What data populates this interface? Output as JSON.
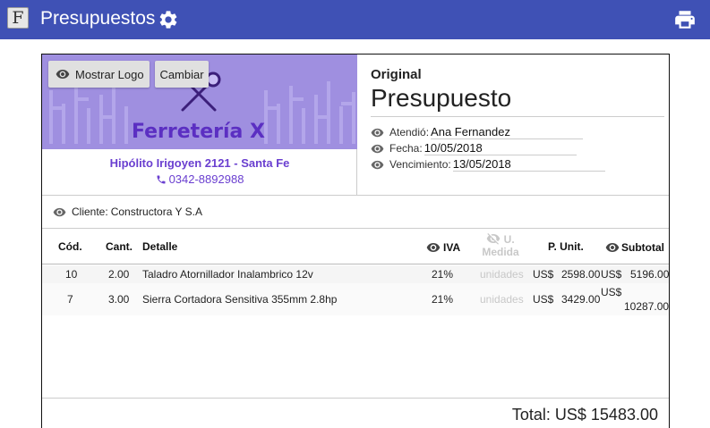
{
  "appbar": {
    "logo_glyph": "F",
    "title": "Presupuestos",
    "settings_icon": "gear-icon",
    "print_icon": "printer-icon",
    "color": "#3f51b5"
  },
  "logo_area": {
    "show_logo_label": "Mostrar Logo",
    "change_label": "Cambiar",
    "brand_name": "Ferretería X",
    "address": "Hipólito Irigoyen 2121 - Santa Fe",
    "phone": "0342-8892988",
    "banner_color": "#9f8fe0",
    "brand_color": "#5b2fc2"
  },
  "header": {
    "copy_type": "Original",
    "title": "Presupuesto",
    "attended_label": "Atendió:",
    "attended_value": "Ana Fernandez",
    "date_label": "Fecha:",
    "date_value": "10/05/2018",
    "expiry_label": "Vencimiento:",
    "expiry_value": "13/05/2018"
  },
  "client": {
    "label": "Cliente:",
    "value": "Constructora Y S.A"
  },
  "table": {
    "headers": {
      "code": "Cód.",
      "qty": "Cant.",
      "detail": "Detalle",
      "iva": "IVA",
      "unit_measure_1": "U.",
      "unit_measure_2": "Medida",
      "unit_price": "P. Unit.",
      "subtotal": "Subtotal"
    },
    "rows": [
      {
        "code": "10",
        "qty": "2.00",
        "detail": "Taladro Atornillador Inalambrico 12v",
        "iva": "21%",
        "unit": "unidades",
        "price_currency": "US$",
        "price": "2598.00",
        "subtotal_currency": "US$",
        "subtotal": "5196.00"
      },
      {
        "code": "7",
        "qty": "3.00",
        "detail": "Sierra Cortadora Sensitiva 355mm 2.8hp",
        "iva": "21%",
        "unit": "unidades",
        "price_currency": "US$",
        "price": "3429.00",
        "subtotal_currency": "US$",
        "subtotal": "10287.00"
      }
    ]
  },
  "total": "Total: US$ 15483.00"
}
